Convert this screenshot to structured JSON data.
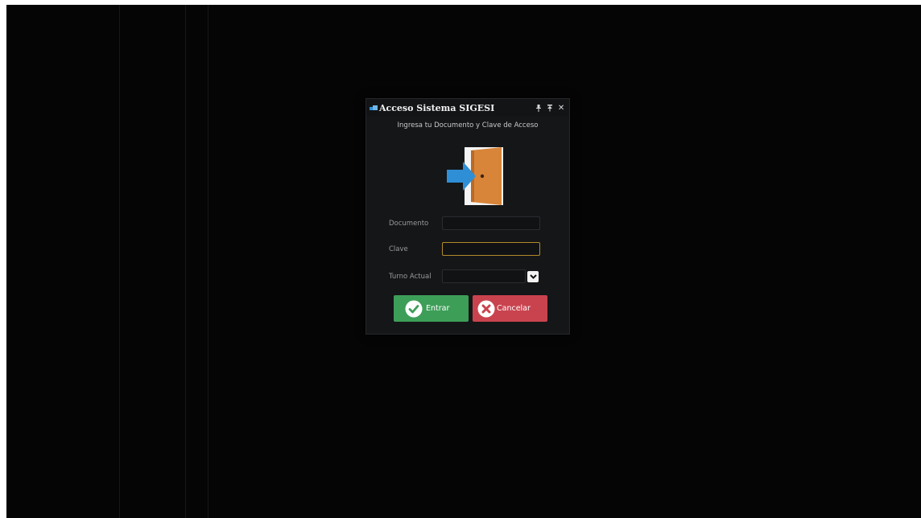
{
  "dialog": {
    "title": "Acceso Sistema SIGESI",
    "subtitle": "Ingresa tu Documento y Clave de Acceso",
    "logo_icon": "door-enter-icon"
  },
  "window_controls": {
    "pin_icon": "pin-icon",
    "restore_icon": "restore-icon",
    "close_icon": "close-icon",
    "close_glyph": "✕"
  },
  "form": {
    "documento_label": "Documento",
    "documento_value": "",
    "clave_label": "Clave",
    "clave_value": "",
    "turno_label": "Turno Actual",
    "turno_value": ""
  },
  "buttons": {
    "entrar_label": "Entrar",
    "entrar_icon": "check-circle-icon",
    "cancelar_label": "Cancelar",
    "cancelar_icon": "x-circle-icon"
  },
  "colors": {
    "background": "#050505",
    "dialog": "#151618",
    "focus_border": "#b38a2c",
    "entrar": "#3d9e58",
    "cancelar": "#c9434e",
    "door": "#d8853a",
    "arrow": "#2f8fd6"
  }
}
